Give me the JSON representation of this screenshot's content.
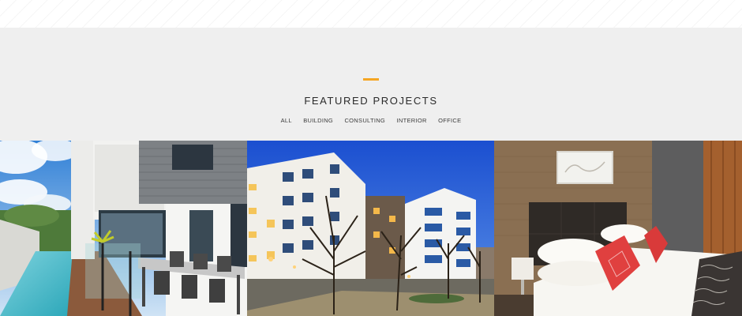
{
  "featured": {
    "title": "FEATURED PROJECTS",
    "filters": [
      "ALL",
      "BUILDING",
      "CONSULTING",
      "INTERIOR",
      "OFFICE"
    ],
    "accent_color": "#f5a623"
  },
  "projects": [
    {
      "subject": "modern-house-patio-pool"
    },
    {
      "subject": "apartment-buildings-dusk"
    },
    {
      "subject": "hotel-bedroom"
    }
  ]
}
